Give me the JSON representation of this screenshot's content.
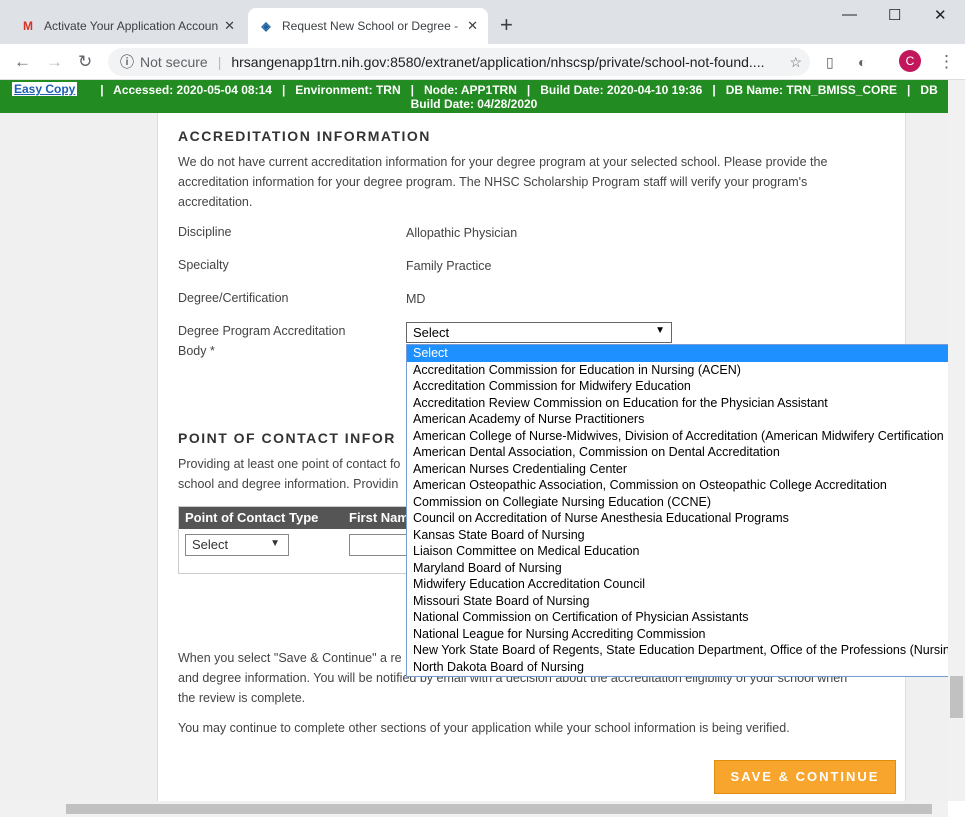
{
  "browser": {
    "tabs": [
      {
        "label": "Activate Your Application Accoun",
        "icon": "gmail-icon"
      },
      {
        "label": "Request New School or Degree -",
        "icon": "hrsa-icon"
      }
    ],
    "security": "Not secure",
    "url": "hrsangenapp1trn.nih.gov:8580/extranet/application/nhscsp/private/school-not-found....",
    "profile_initial": "C"
  },
  "envbar": {
    "easy_copy": "Easy Copy",
    "line1": "|   Accessed: 2020-05-04 08:14   |   Environment: TRN   |   Node: APP1TRN   |   Build Date: 2020-04-10 19:36   |   DB Name: TRN_BMISS_CORE   |   DB",
    "line2": "Build Date: 04/28/2020"
  },
  "accreditation": {
    "heading": "ACCREDITATION INFORMATION",
    "intro": [
      "We do not have current accreditation information for your degree program at your selected school. Please provide the",
      "accreditation information for your degree program. The NHSC Scholarship Program staff will verify your program's",
      "accreditation."
    ],
    "fields": [
      {
        "label": "Discipline",
        "value": "Allopathic Physician"
      },
      {
        "label": "Specialty",
        "value": "Family Practice"
      },
      {
        "label": "Degree/Certification",
        "value": "MD"
      }
    ],
    "body_label": [
      "Degree Program Accreditation",
      "Body *"
    ],
    "body_selected": "Select",
    "options": [
      "Select",
      "Accreditation Commission for Education in Nursing (ACEN)",
      "Accreditation Commission for Midwifery Education",
      "Accreditation Review Commission on Education for the Physician Assistant",
      "American Academy of Nurse Practitioners",
      "American College of Nurse-Midwives, Division of Accreditation (American Midwifery Certification",
      "American Dental Association, Commission on Dental Accreditation",
      "American Nurses Credentialing Center",
      "American Osteopathic Association, Commission on Osteopathic College Accreditation",
      "Commission on Collegiate Nursing Education (CCNE)",
      "Council on Accreditation of Nurse Anesthesia Educational Programs",
      "Kansas State Board of Nursing",
      "Liaison Committee on Medical Education",
      "Maryland Board of Nursing",
      "Midwifery Education Accreditation Council",
      "Missouri State Board of Nursing",
      "National Commission on Certification of Physician Assistants",
      "National League for Nursing Accrediting Commission",
      "New York State Board of Regents, State Education Department, Office of the Professions (Nursing",
      "North Dakota Board of Nursing"
    ]
  },
  "poc": {
    "heading": "POINT OF CONTACT INFOR",
    "intro": [
      "Providing at least one point of contact fo",
      "school and degree information. Providin"
    ],
    "col_type": "Point of Contact Type",
    "col_first": "First Nam",
    "type_selected": "Select"
  },
  "footer": {
    "para1": [
      "When you select \"Save & Continue\" a re",
      "and degree information. You will be notified by email with a decision about the accreditation eligibility of your school when",
      "the review is complete."
    ],
    "para2": "You may continue to complete other sections of your application while your school information is being verified.",
    "save": "SAVE & CONTINUE"
  }
}
